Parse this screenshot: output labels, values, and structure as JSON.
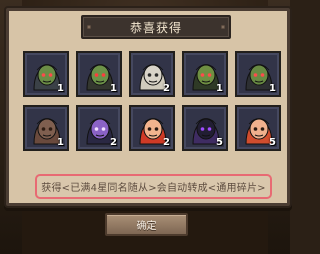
{
  "title": "恭喜获得",
  "notice": "获得<已满4星同名随从>会自动转成<通用碎片>",
  "confirm_label": "确定",
  "colors": {
    "panel": "#d7c4a7",
    "title_bar": "#3c332d",
    "slot_bg": "#323448",
    "notice_border": "#e86a73",
    "button": "#9a806a"
  },
  "items": [
    {
      "count": "1",
      "skin": "#6b8d46",
      "hood": "#3b4147",
      "eye": "#ff4b4b"
    },
    {
      "count": "1",
      "skin": "#6c9248",
      "hood": "#34372f",
      "eye": "#ff3d3d"
    },
    {
      "count": "2",
      "skin": "#d8d3c8",
      "hood": "#d0cbbd",
      "eye": "#2b2b2b"
    },
    {
      "count": "1",
      "skin": "#6f8f42",
      "hood": "#2f3a26",
      "eye": "#ff4b4b"
    },
    {
      "count": "1",
      "skin": "#688a43",
      "hood": "#2d2f32",
      "eye": "#ff4b4b"
    },
    {
      "count": "1",
      "skin": "#7f5f4f",
      "hood": "#6a4a3d",
      "eye": "#2f1d13"
    },
    {
      "count": "2",
      "skin": "#8a62c5",
      "hood": "#2a2843",
      "eye": "#f1dfff"
    },
    {
      "count": "2",
      "skin": "#f2b38d",
      "hood": "#cf3a26",
      "eye": "#2a1a12"
    },
    {
      "count": "5",
      "skin": "#221e33",
      "hood": "#3f2c63",
      "eye": "#9f4dff"
    },
    {
      "count": "5",
      "skin": "#f0b08d",
      "hood": "#d14d2e",
      "eye": "#2a1a12"
    }
  ]
}
